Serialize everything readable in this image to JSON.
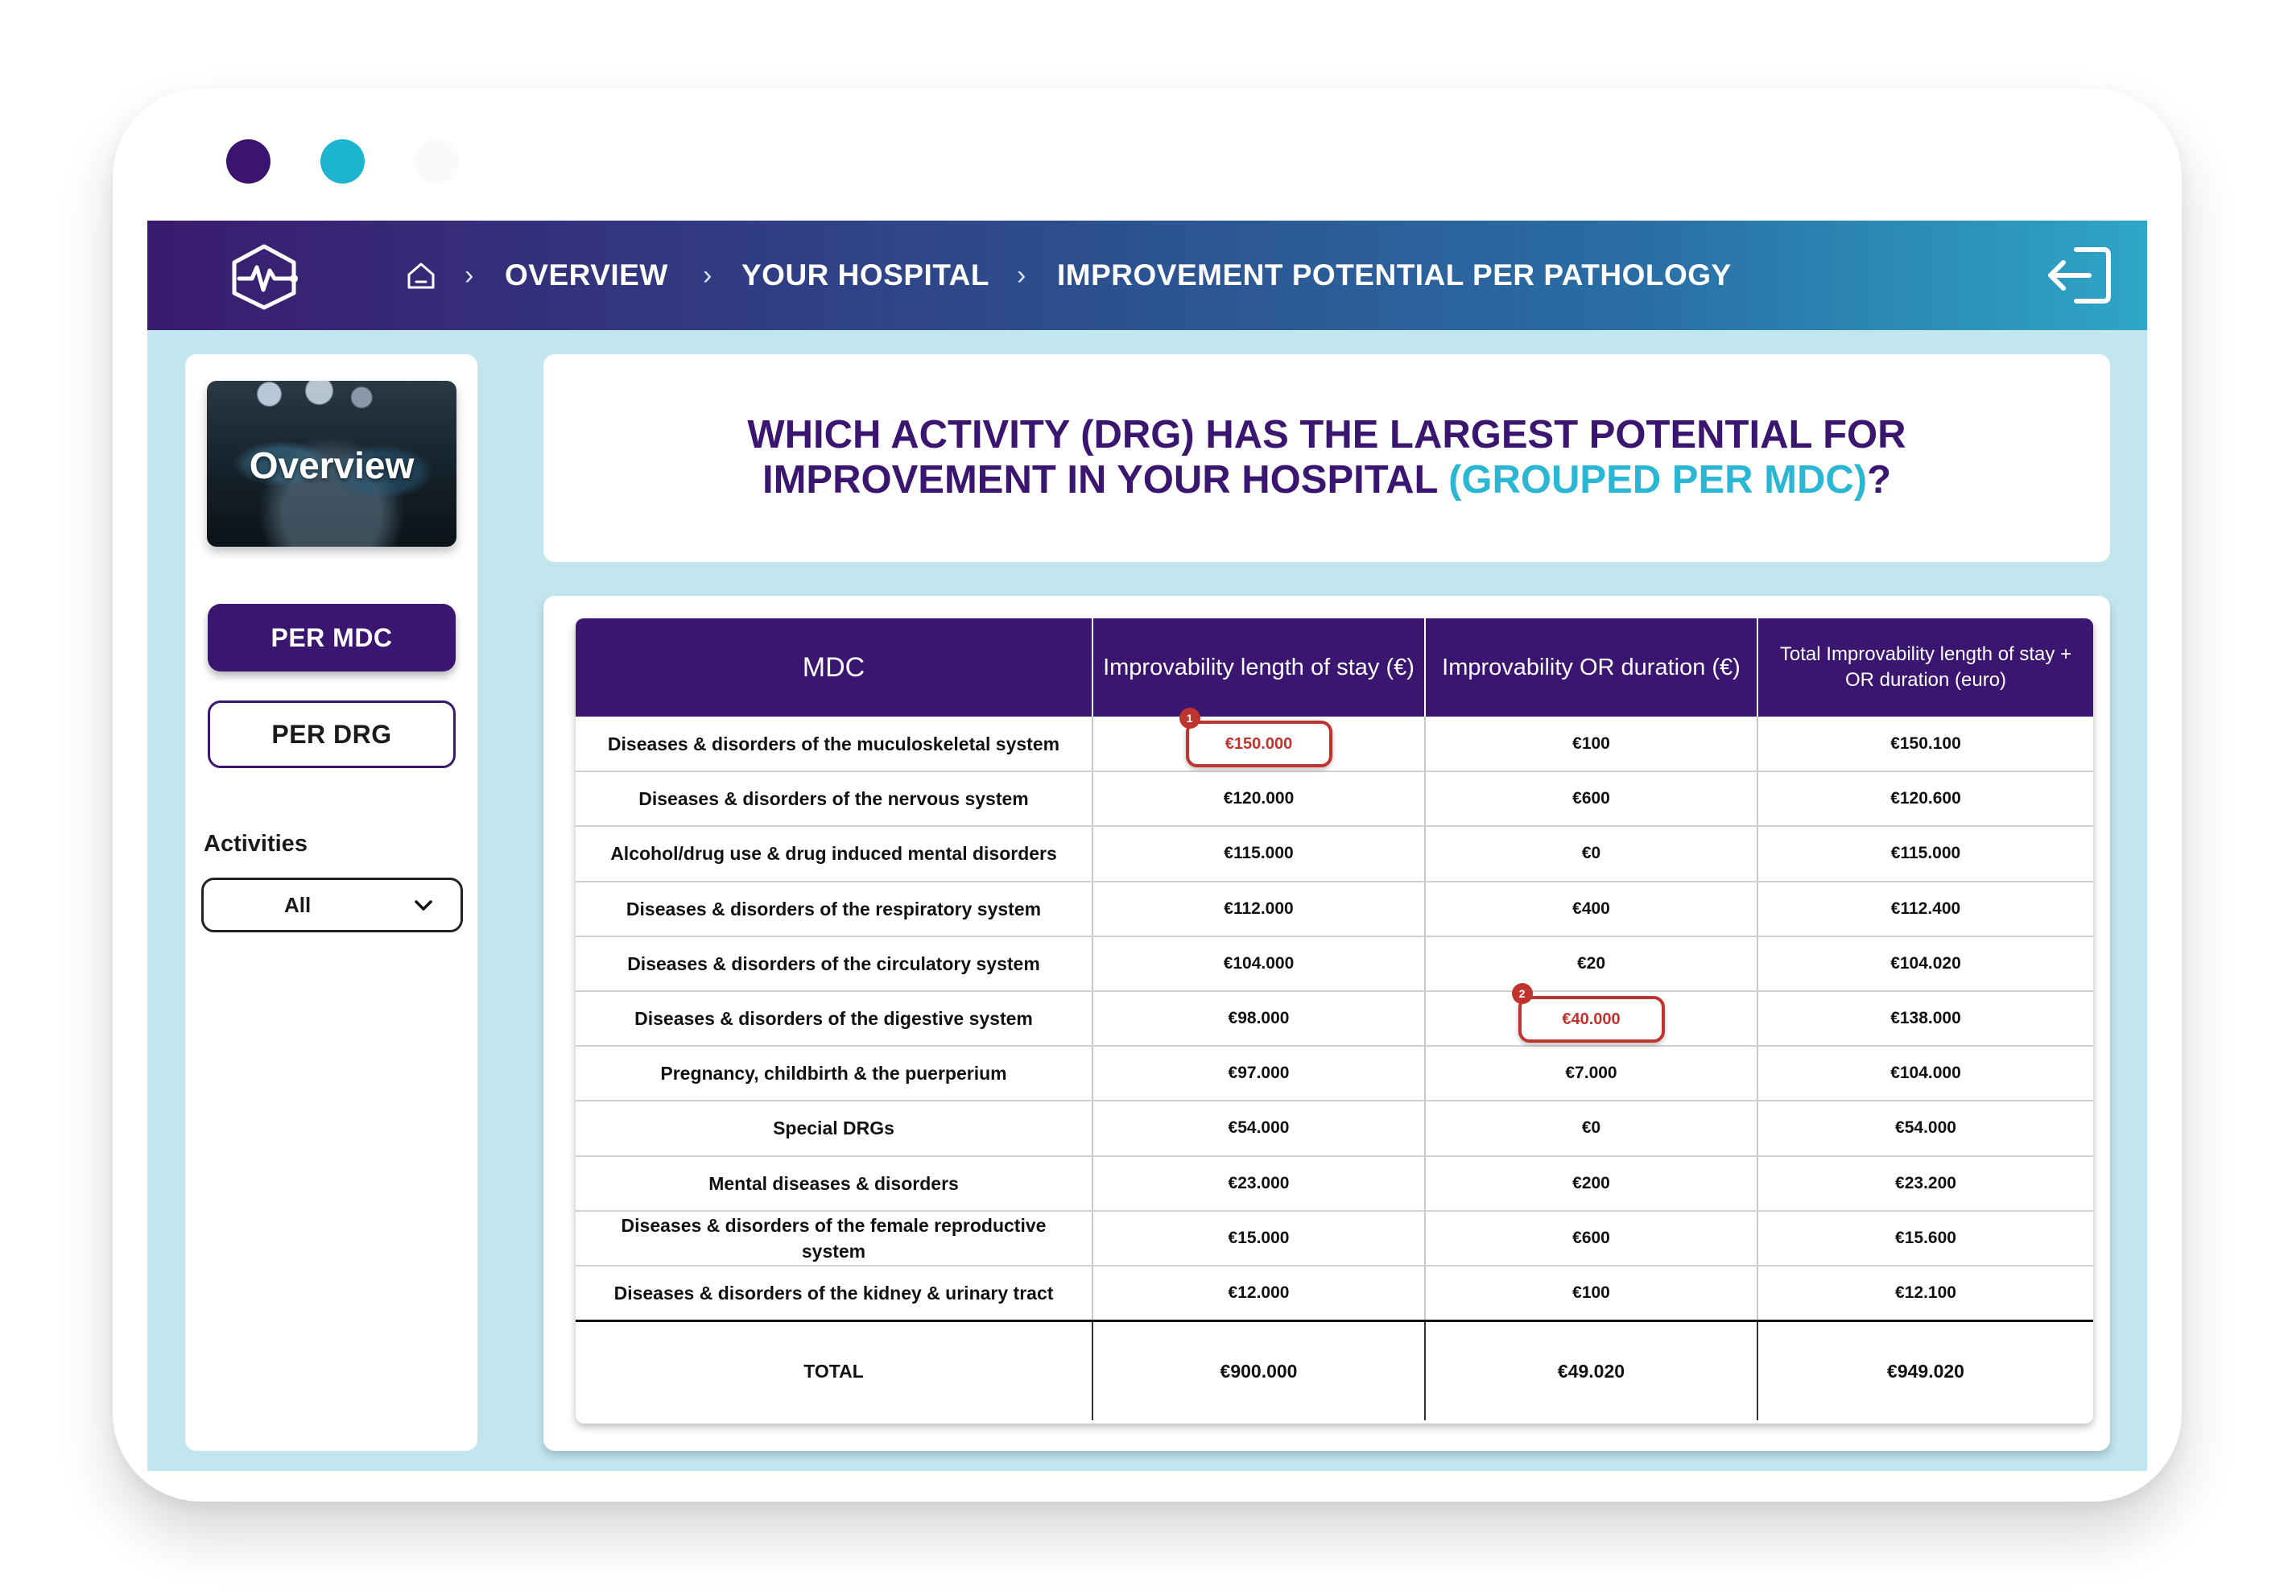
{
  "breadcrumb": {
    "items": [
      "OVERVIEW",
      "YOUR HOSPITAL",
      "IMPROVEMENT POTENTIAL PER PATHOLOGY"
    ]
  },
  "sidebar": {
    "overview_label": "Overview",
    "per_mdc_label": "PER MDC",
    "per_drg_label": "PER DRG",
    "activities_label": "Activities",
    "activities_value": "All"
  },
  "question": {
    "line1": "WHICH ACTIVITY (DRG) HAS THE LARGEST POTENTIAL FOR",
    "line2_start": "IMPROVEMENT IN YOUR HOSPITAL ",
    "line2_accent": "(GROUPED PER MDC)",
    "line2_end": "?"
  },
  "table": {
    "headers": {
      "mdc": "MDC",
      "los": "Improvability length of stay (€)",
      "or": "Improvability OR duration (€)",
      "total": "Total Improvability length of stay + OR duration (euro)"
    },
    "rows": [
      {
        "mdc": "Diseases & disorders of the muculoskeletal system",
        "los": "€150.000",
        "or": "€100",
        "total": "€150.100"
      },
      {
        "mdc": "Diseases & disorders of the nervous system",
        "los": "€120.000",
        "or": "€600",
        "total": "€120.600"
      },
      {
        "mdc": "Alcohol/drug use & drug induced mental disorders",
        "los": "€115.000",
        "or": "€0",
        "total": "€115.000"
      },
      {
        "mdc": "Diseases & disorders of the respiratory system",
        "los": "€112.000",
        "or": "€400",
        "total": "€112.400"
      },
      {
        "mdc": "Diseases & disorders of the circulatory system",
        "los": "€104.000",
        "or": "€20",
        "total": "€104.020"
      },
      {
        "mdc": "Diseases & disorders of the digestive system",
        "los": "€98.000",
        "or": "€40.000",
        "total": "€138.000"
      },
      {
        "mdc": "Pregnancy, childbirth & the puerperium",
        "los": "€97.000",
        "or": "€7.000",
        "total": "€104.000"
      },
      {
        "mdc": "Special DRGs",
        "los": "€54.000",
        "or": "€0",
        "total": "€54.000"
      },
      {
        "mdc": "Mental diseases & disorders",
        "los": "€23.000",
        "or": "€200",
        "total": "€23.200"
      },
      {
        "mdc": "Diseases & disorders of the female reproductive system",
        "los": "€15.000",
        "or": "€600",
        "total": "€15.600"
      },
      {
        "mdc": "Diseases & disorders of the kidney & urinary tract",
        "los": "€12.000",
        "or": "€100",
        "total": "€12.100"
      }
    ],
    "total": {
      "label": "TOTAL",
      "los": "€900.000",
      "or": "€49.020",
      "total": "€949.020"
    },
    "callouts": {
      "first": "1",
      "second": "2"
    }
  },
  "colors": {
    "brand_purple": "#3a1670",
    "accent_cyan": "#2bb6d3",
    "highlight_red": "#c0342e",
    "screen_bg": "#c1e6ee"
  }
}
